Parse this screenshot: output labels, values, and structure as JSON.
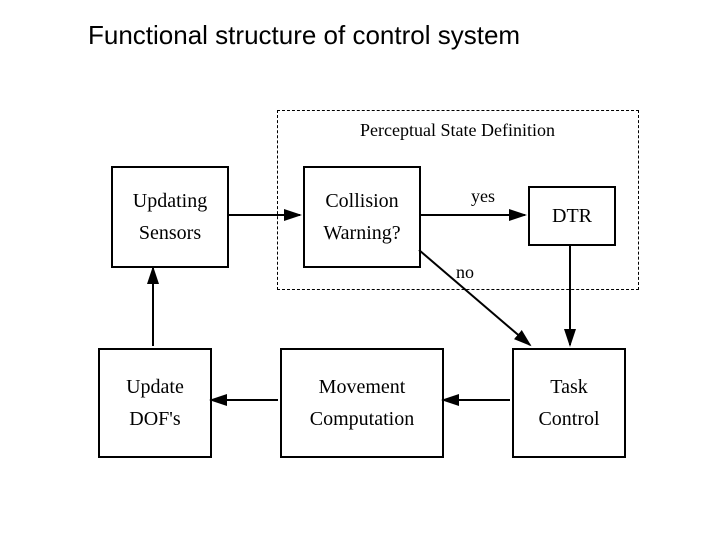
{
  "title": "Functional structure of control system",
  "dashed_area": {
    "label": "Perceptual State Definition"
  },
  "boxes": {
    "updating_sensors": {
      "line1": "Updating",
      "line2": "Sensors"
    },
    "collision_warning": {
      "line1": "Collision",
      "line2": "Warning?"
    },
    "dtr": {
      "line1": "DTR"
    },
    "update_dofs": {
      "line1": "Update",
      "line2": "DOF's"
    },
    "movement_computation": {
      "line1": "Movement",
      "line2": "Computation"
    },
    "task_control": {
      "line1": "Task",
      "line2": "Control"
    }
  },
  "edges": {
    "yes": "yes",
    "no": "no"
  }
}
